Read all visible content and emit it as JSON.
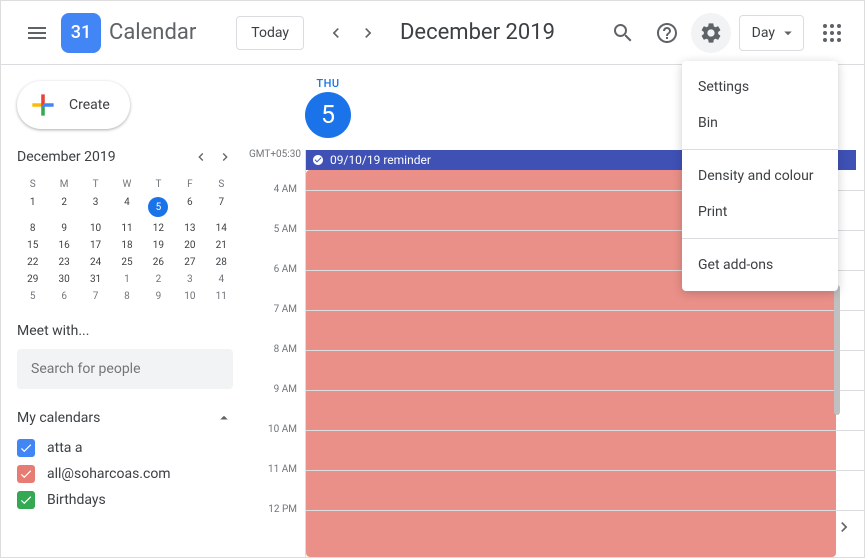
{
  "header": {
    "logo_day": "31",
    "app_title": "Calendar",
    "today_label": "Today",
    "month_label": "December 2019",
    "view_label": "Day"
  },
  "sidebar": {
    "create_label": "Create",
    "minical": {
      "month": "December 2019",
      "dow": [
        "S",
        "M",
        "T",
        "W",
        "T",
        "F",
        "S"
      ],
      "weeks": [
        [
          {
            "d": "1"
          },
          {
            "d": "2"
          },
          {
            "d": "3"
          },
          {
            "d": "4"
          },
          {
            "d": "5",
            "today": true
          },
          {
            "d": "6"
          },
          {
            "d": "7"
          }
        ],
        [
          {
            "d": "8"
          },
          {
            "d": "9"
          },
          {
            "d": "10"
          },
          {
            "d": "11"
          },
          {
            "d": "12"
          },
          {
            "d": "13"
          },
          {
            "d": "14"
          }
        ],
        [
          {
            "d": "15"
          },
          {
            "d": "16"
          },
          {
            "d": "17"
          },
          {
            "d": "18"
          },
          {
            "d": "19"
          },
          {
            "d": "20"
          },
          {
            "d": "21"
          }
        ],
        [
          {
            "d": "22"
          },
          {
            "d": "23"
          },
          {
            "d": "24"
          },
          {
            "d": "25"
          },
          {
            "d": "26"
          },
          {
            "d": "27"
          },
          {
            "d": "28"
          }
        ],
        [
          {
            "d": "29"
          },
          {
            "d": "30"
          },
          {
            "d": "31"
          },
          {
            "d": "1",
            "other": true
          },
          {
            "d": "2",
            "other": true
          },
          {
            "d": "3",
            "other": true
          },
          {
            "d": "4",
            "other": true
          }
        ],
        [
          {
            "d": "5",
            "other": true
          },
          {
            "d": "6",
            "other": true
          },
          {
            "d": "7",
            "other": true
          },
          {
            "d": "8",
            "other": true
          },
          {
            "d": "9",
            "other": true
          },
          {
            "d": "10",
            "other": true
          },
          {
            "d": "11",
            "other": true
          }
        ]
      ]
    },
    "meet_label": "Meet with...",
    "search_placeholder": "Search for people",
    "my_calendars_label": "My calendars",
    "calendars": [
      {
        "name": "atta a",
        "color": "#4285f4"
      },
      {
        "name": "all@soharcoas.com",
        "color": "#e67c73"
      },
      {
        "name": "Birthdays",
        "color": "#34a853"
      }
    ]
  },
  "main": {
    "timezone": "GMT+05:30",
    "dow": "THU",
    "day": "5",
    "hours": [
      "",
      "4 AM",
      "5 AM",
      "6 AM",
      "7 AM",
      "8 AM",
      "9 AM",
      "10 AM",
      "11 AM",
      "12 PM"
    ],
    "allday_event": "09/10/19 reminder"
  },
  "settings_menu": {
    "items": [
      {
        "label": "Settings"
      },
      {
        "label": "Bin"
      },
      {
        "divider": true
      },
      {
        "label": "Density and colour"
      },
      {
        "label": "Print"
      },
      {
        "divider": true
      },
      {
        "label": "Get add-ons"
      }
    ]
  }
}
